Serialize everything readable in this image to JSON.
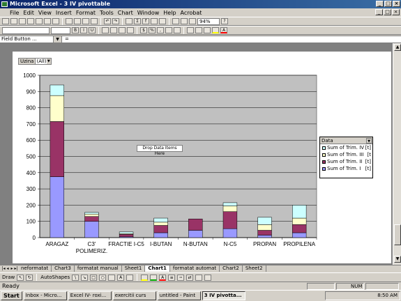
{
  "window": {
    "title": "Microsoft Excel - 3 IV pivottable"
  },
  "menu": [
    "File",
    "Edit",
    "View",
    "Insert",
    "Format",
    "Tools",
    "Chart",
    "Window",
    "Help",
    "Acrobat"
  ],
  "toolbar": {
    "zoom": "94%"
  },
  "formula_bar": {
    "name_box": "Field Button ...",
    "fx": "="
  },
  "pivot": {
    "page_field": {
      "label": "Uzina",
      "value": "(All)"
    },
    "drop_hint": "Drop Data Items Here",
    "legend_title": "Data",
    "legend_flags": [
      "[t]",
      "[t",
      "[t]",
      "[t]"
    ]
  },
  "chart_data": {
    "type": "bar",
    "stacked": true,
    "categories": [
      "ARAGAZ",
      "C3'\nPOLIMERIZ.",
      "FRACTIE I-C5",
      "I-BUTAN",
      "N-BUTAN",
      "N-C5",
      "PROPAN",
      "PROPILENA"
    ],
    "ylim": [
      0,
      1000
    ],
    "yticks": [
      0,
      100,
      200,
      300,
      400,
      500,
      600,
      700,
      800,
      900,
      1000
    ],
    "grid": true,
    "legend_position": "right",
    "series": [
      {
        "name": "Sum of Trim. I",
        "color": "#9999ff",
        "values": [
          375,
          100,
          5,
          30,
          45,
          55,
          15,
          30
        ]
      },
      {
        "name": "Sum of Trim. II",
        "color": "#993366",
        "values": [
          340,
          30,
          15,
          45,
          70,
          105,
          30,
          50
        ]
      },
      {
        "name": "Sum of Trim. III",
        "color": "#ffffcc",
        "values": [
          160,
          15,
          5,
          20,
          0,
          35,
          35,
          40
        ]
      },
      {
        "name": "Sum of Trim. IV",
        "color": "#ccffff",
        "values": [
          65,
          10,
          10,
          25,
          0,
          20,
          45,
          80
        ]
      }
    ]
  },
  "sheet_tabs": [
    "neformatat",
    "Chart3",
    "formatat manual",
    "Sheet1",
    "Chart1",
    "formatat automat",
    "Chart2",
    "Sheet2"
  ],
  "active_tab": "Chart1",
  "drawbar": {
    "draw": "Draw",
    "autoshapes": "AutoShapes"
  },
  "status": {
    "left": "Ready",
    "num": "NUM"
  },
  "taskbar": {
    "start": "Start",
    "items": [
      "Inbox - Micro...",
      "Excel IV- roxi...",
      "exercitii curs",
      "untitled - Paint",
      "3 IV pivotta..."
    ],
    "active": "3 IV pivotta...",
    "clock": "8:50 AM"
  }
}
